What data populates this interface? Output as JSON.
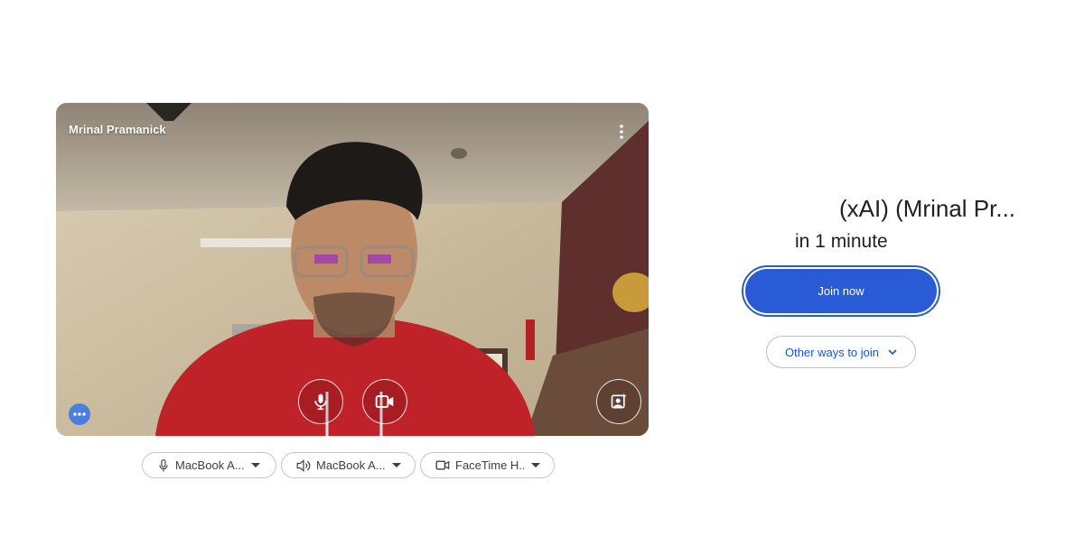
{
  "preview": {
    "participant_name": "Mrinal Pramanick"
  },
  "controls": {
    "mic_icon": "mic-icon",
    "camera_icon": "videocam-icon",
    "effects_icon": "visual-effects-icon",
    "more_icon": "more-vert-icon"
  },
  "devices": {
    "microphone_label": "MacBook A...",
    "speaker_label": "MacBook A...",
    "camera_label": "FaceTime H..."
  },
  "join_panel": {
    "meeting_title": "(xAI) (Mrinal Pr...",
    "start_time": "in 1 minute",
    "join_label": "Join now",
    "other_ways_label": "Other ways to join"
  },
  "colors": {
    "join_button": "#2a5bd7",
    "link_blue": "#1a56c4"
  }
}
